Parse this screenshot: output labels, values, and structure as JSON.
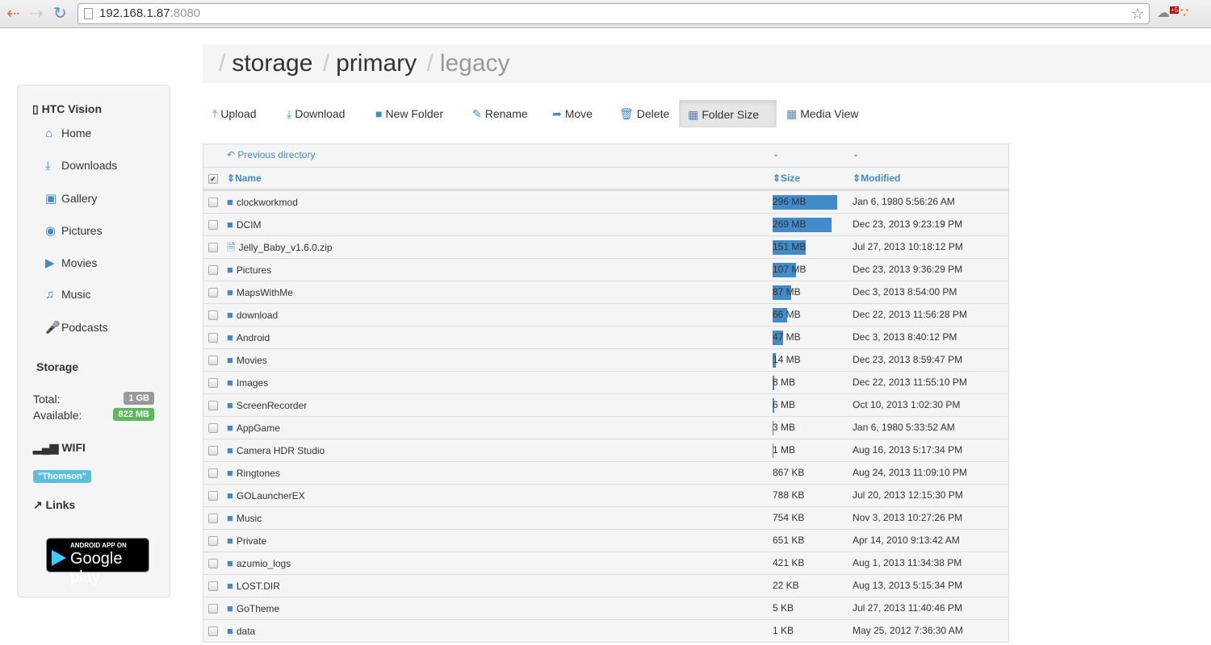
{
  "browser": {
    "url_host": "192.168.1.87",
    "url_port": ":8080",
    "ext_badge": "+5"
  },
  "breadcrumb": [
    "storage",
    "primary",
    "legacy"
  ],
  "sidebar": {
    "device": "HTC Vision",
    "items": [
      {
        "label": "Home",
        "icon": "home-icon"
      },
      {
        "label": "Downloads",
        "icon": "download-icon"
      },
      {
        "label": "Gallery",
        "icon": "image-icon"
      },
      {
        "label": "Pictures",
        "icon": "camera-icon"
      },
      {
        "label": "Movies",
        "icon": "video-icon"
      },
      {
        "label": "Music",
        "icon": "music-icon"
      },
      {
        "label": "Podcasts",
        "icon": "microphone-icon"
      }
    ],
    "storage_title": "Storage",
    "total_label": "Total:",
    "total": "1 GB",
    "available_label": "Available:",
    "available": "822 MB",
    "wifi_title": "WIFI",
    "wifi_name": "\"Thomson\"",
    "links_title": "Links",
    "play_small": "ANDROID APP ON",
    "play_big": "Google play"
  },
  "toolbar": [
    {
      "label": "Upload",
      "icon": "upload-icon"
    },
    {
      "label": "Download",
      "icon": "download-icon"
    },
    {
      "label": "New Folder",
      "icon": "folder-icon"
    },
    {
      "label": "Rename",
      "icon": "pencil-icon"
    },
    {
      "label": "Move",
      "icon": "share-icon"
    },
    {
      "label": "Delete",
      "icon": "trash-icon"
    },
    {
      "label": "Folder Size",
      "icon": "bar-chart-icon",
      "active": true
    },
    {
      "label": "Media View",
      "icon": "grid-icon"
    }
  ],
  "table": {
    "prev": "Previous directory",
    "prev_size": "-",
    "prev_mod": "-",
    "headers": {
      "name": "Name",
      "size": "Size",
      "modified": "Modified"
    },
    "rows": [
      {
        "name": "clockworkmod",
        "type": "folder",
        "size": "296 MB",
        "bar": 1.0,
        "mod": "Jan 6, 1980 5:56:26 AM"
      },
      {
        "name": "DCIM",
        "type": "folder",
        "size": "269 MB",
        "bar": 0.91,
        "mod": "Dec 23, 2013 9:23:19 PM"
      },
      {
        "name": "Jelly_Baby_v1.6.0.zip",
        "type": "file",
        "size": "151 MB",
        "bar": 0.51,
        "mod": "Jul 27, 2013 10:18:12 PM"
      },
      {
        "name": "Pictures",
        "type": "folder",
        "size": "107 MB",
        "bar": 0.36,
        "mod": "Dec 23, 2013 9:36:29 PM"
      },
      {
        "name": "MapsWithMe",
        "type": "folder",
        "size": "87 MB",
        "bar": 0.29,
        "mod": "Dec 3, 2013 8:54:00 PM"
      },
      {
        "name": "download",
        "type": "folder",
        "size": "66 MB",
        "bar": 0.22,
        "mod": "Dec 22, 2013 11:56:28 PM"
      },
      {
        "name": "Android",
        "type": "folder",
        "size": "47 MB",
        "bar": 0.16,
        "mod": "Dec 3, 2013 8:40:12 PM"
      },
      {
        "name": "Movies",
        "type": "folder",
        "size": "14 MB",
        "bar": 0.05,
        "mod": "Dec 23, 2013 8:59:47 PM"
      },
      {
        "name": "Images",
        "type": "folder",
        "size": "8 MB",
        "bar": 0.027,
        "mod": "Dec 22, 2013 11:55:10 PM"
      },
      {
        "name": "ScreenRecorder",
        "type": "folder",
        "size": "6 MB",
        "bar": 0.02,
        "mod": "Oct 10, 2013 1:02:30 PM"
      },
      {
        "name": "AppGame",
        "type": "folder",
        "size": "3 MB",
        "bar": 0.01,
        "mod": "Jan 6, 1980 5:33:52 AM"
      },
      {
        "name": "Camera HDR Studio",
        "type": "folder",
        "size": "1 MB",
        "bar": 0.004,
        "mod": "Aug 16, 2013 5:17:34 PM"
      },
      {
        "name": "Ringtones",
        "type": "folder",
        "size": "867 KB",
        "bar": 0,
        "mod": "Aug 24, 2013 11:09:10 PM"
      },
      {
        "name": "GOLauncherEX",
        "type": "folder",
        "size": "788 KB",
        "bar": 0,
        "mod": "Jul 20, 2013 12:15:30 PM"
      },
      {
        "name": "Music",
        "type": "folder",
        "size": "754 KB",
        "bar": 0,
        "mod": "Nov 3, 2013 10:27:26 PM"
      },
      {
        "name": "Private",
        "type": "folder",
        "size": "651 KB",
        "bar": 0,
        "mod": "Apr 14, 2010 9:13:42 AM"
      },
      {
        "name": "azumio_logs",
        "type": "folder",
        "size": "421 KB",
        "bar": 0,
        "mod": "Aug 1, 2013 11:34:38 PM"
      },
      {
        "name": "LOST.DIR",
        "type": "folder",
        "size": "22 KB",
        "bar": 0,
        "mod": "Aug 13, 2013 5:15:34 PM"
      },
      {
        "name": "GoTheme",
        "type": "folder",
        "size": "5 KB",
        "bar": 0,
        "mod": "Jul 27, 2013 11:40:46 PM"
      },
      {
        "name": "data",
        "type": "folder",
        "size": "1 KB",
        "bar": 0,
        "mod": "May 25, 2012 7:36:30 AM"
      }
    ]
  }
}
